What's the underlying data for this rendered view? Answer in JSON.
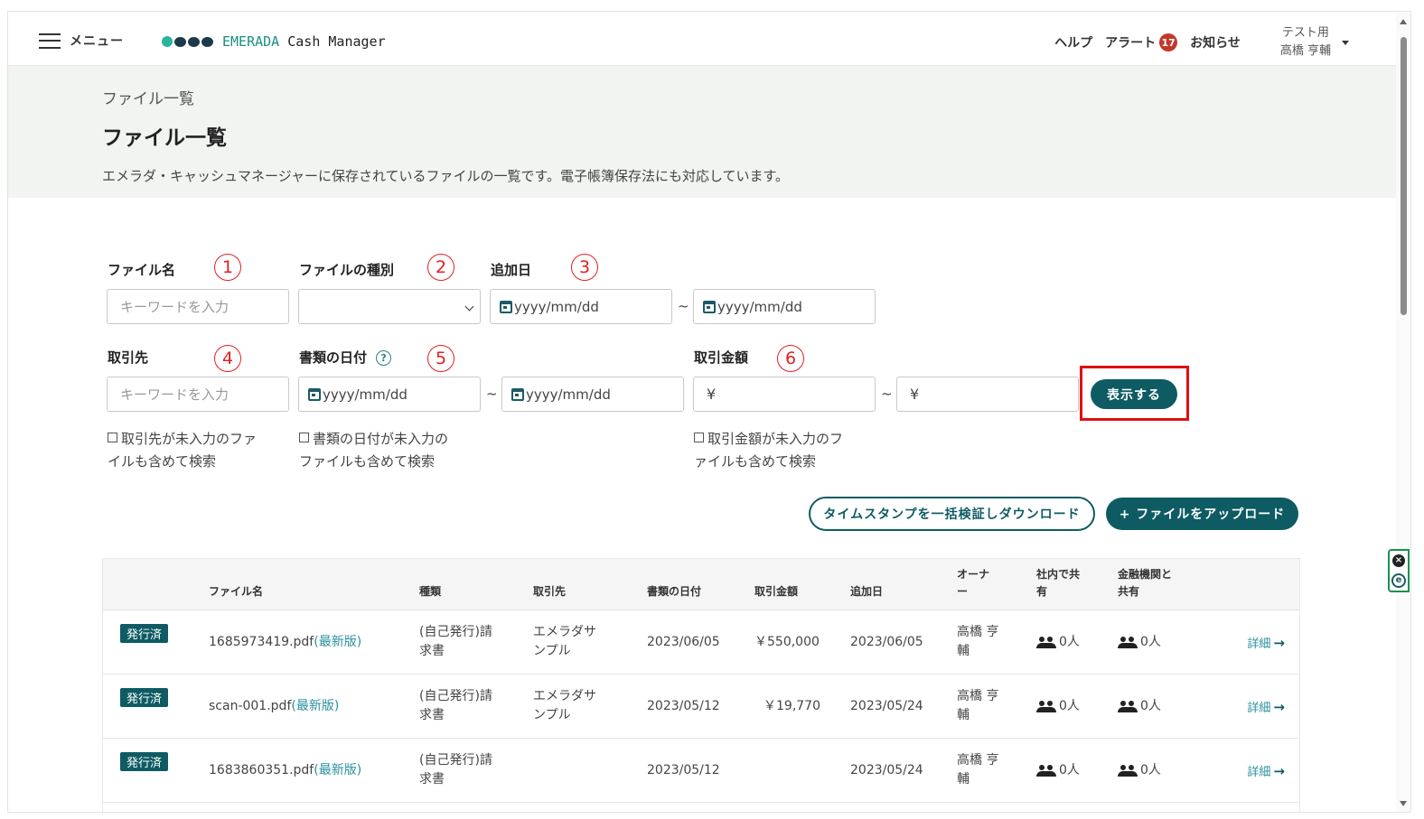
{
  "header": {
    "menu_label": "メニュー",
    "brand_prefix": "EMERADA",
    "brand_suffix": " Cash Manager",
    "help": "ヘルプ",
    "alert": "アラート",
    "alert_count": "17",
    "notice": "お知らせ",
    "user_line1": "テスト用",
    "user_line2": "高橋 亨輔"
  },
  "page": {
    "breadcrumb": "ファイル一覧",
    "title": "ファイル一覧",
    "description": "エメラダ・キャッシュマネージャーに保存されているファイルの一覧です。電子帳簿保存法にも対応しています。"
  },
  "filters": {
    "file_name_label": "ファイル名",
    "file_name_placeholder": "キーワードを入力",
    "file_type_label": "ファイルの種別",
    "file_type_value": "",
    "added_date_label": "追加日",
    "date_placeholder": "yyyy/mm/dd",
    "partner_label": "取引先",
    "partner_placeholder": "キーワードを入力",
    "doc_date_label": "書類の日付",
    "help_mark": "?",
    "amount_label": "取引金額",
    "yen": "¥",
    "tilde": "~",
    "partner_check_1": "取引先が未入力のファ",
    "partner_check_2": "イルも含めて検索",
    "docdate_check_1": "書類の日付が未入力の",
    "docdate_check_2": "ファイルも含めて検索",
    "amount_check_1": "取引金額が未入力のフ",
    "amount_check_2": "ァイルも含めて検索",
    "markers": [
      "1",
      "2",
      "3",
      "4",
      "5",
      "6"
    ]
  },
  "actions": {
    "show": "表示する",
    "timestamp_download": "タイムスタンプを一括検証しダウンロード",
    "upload": "+ ファイルをアップロード"
  },
  "table": {
    "headers": {
      "file_name": "ファイル名",
      "type": "種類",
      "partner": "取引先",
      "doc_date": "書類の日付",
      "amount": "取引金額",
      "added": "追加日",
      "owner_1": "オーナ",
      "owner_2": "ー",
      "internal_1": "社内で共",
      "internal_2": "有",
      "bank_1": "金融機関と",
      "bank_2": "共有"
    },
    "rows": [
      {
        "status": "発行済",
        "file": "1685973419.pdf",
        "latest": "(最新版)",
        "type_1": "(自己発行)請",
        "type_2": "求書",
        "partner_1": "エメラダサ",
        "partner_2": "ンプル",
        "doc_date": "2023/06/05",
        "amount": "￥550,000",
        "added": "2023/06/05",
        "owner_1": "高橋 亨",
        "owner_2": "輔",
        "internal": "0人",
        "bank": "0人",
        "detail": "詳細"
      },
      {
        "status": "発行済",
        "file": "scan-001.pdf",
        "latest": "(最新版)",
        "type_1": "(自己発行)請",
        "type_2": "求書",
        "partner_1": "エメラダサ",
        "partner_2": "ンプル",
        "doc_date": "2023/05/12",
        "amount": "￥19,770",
        "added": "2023/05/24",
        "owner_1": "高橋 亨",
        "owner_2": "輔",
        "internal": "0人",
        "bank": "0人",
        "detail": "詳細"
      },
      {
        "status": "発行済",
        "file": "1683860351.pdf",
        "latest": "(最新版)",
        "type_1": "(自己発行)請",
        "type_2": "求書",
        "partner_1": "",
        "partner_2": "",
        "doc_date": "2023/05/12",
        "amount": "",
        "added": "2023/05/24",
        "owner_1": "高橋 亨",
        "owner_2": "輔",
        "internal": "0人",
        "bank": "0人",
        "detail": "詳細"
      }
    ]
  },
  "colors": {
    "accent": "#0e5b63",
    "highlight": "#e01010",
    "title_band": "#f2f4f1"
  }
}
